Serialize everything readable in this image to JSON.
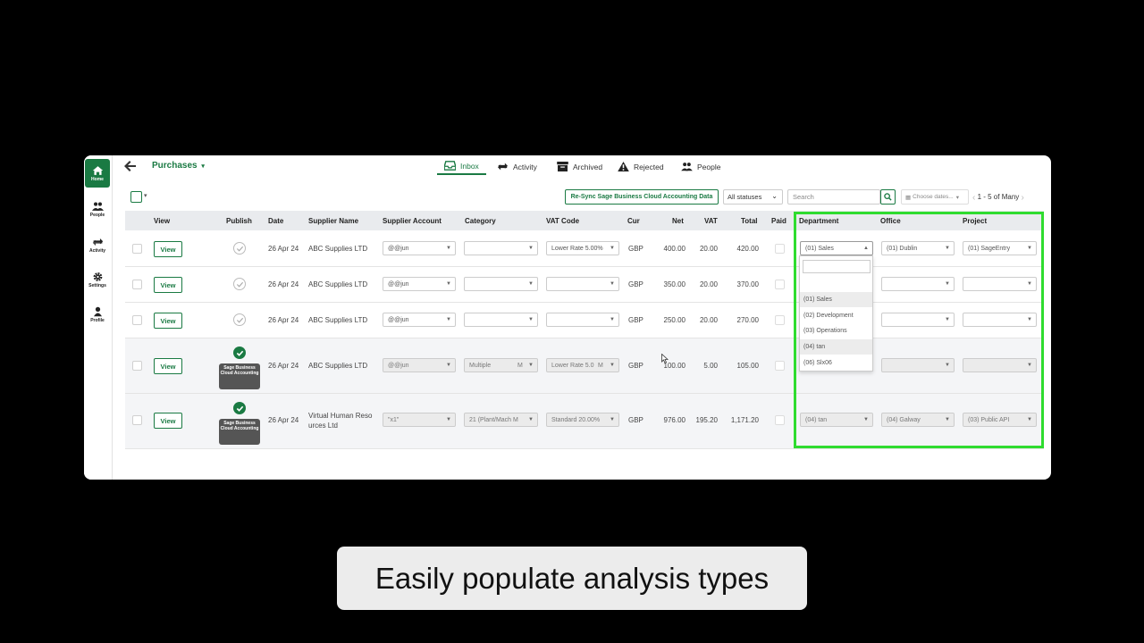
{
  "sidebar": {
    "items": [
      {
        "label": "Home",
        "icon": "home-icon",
        "active": true
      },
      {
        "label": "People",
        "icon": "people-icon"
      },
      {
        "label": "Activity",
        "icon": "activity-icon"
      },
      {
        "label": "Settings",
        "icon": "gear-icon"
      },
      {
        "label": "Profile",
        "icon": "profile-icon"
      }
    ]
  },
  "header": {
    "title": "Purchases",
    "tabs": [
      {
        "label": "Inbox",
        "active": true
      },
      {
        "label": "Activity"
      },
      {
        "label": "Archived"
      },
      {
        "label": "Rejected"
      },
      {
        "label": "People"
      }
    ]
  },
  "toolbar": {
    "resync_label": "Re-Sync Sage Business Cloud Accounting Data",
    "status_filter": "All statuses",
    "search_placeholder": "Search",
    "date_placeholder": "Choose dates...",
    "pagination": "1 - 5 of Many"
  },
  "table": {
    "columns": [
      "View",
      "Publish",
      "Date",
      "Supplier Name",
      "Supplier Account",
      "Category",
      "VAT Code",
      "Cur",
      "Net",
      "VAT",
      "Total",
      "Paid",
      "Department",
      "Office",
      "Project"
    ],
    "view_label": "View",
    "rows": [
      {
        "date": "26 Apr 24",
        "supplier": "ABC Supplies LTD",
        "account": "@@jun",
        "category": "",
        "vat_code": "Lower Rate 5.00%",
        "cur": "GBP",
        "net": "400.00",
        "vat": "20.00",
        "total": "420.00",
        "department": "(01) Sales",
        "office": "(01) Dublin",
        "project": "(01) SageEntry"
      },
      {
        "date": "26 Apr 24",
        "supplier": "ABC Supplies LTD",
        "account": "@@jun",
        "category": "",
        "vat_code": "",
        "cur": "GBP",
        "net": "350.00",
        "vat": "20.00",
        "total": "370.00",
        "department": "",
        "office": "",
        "project": ""
      },
      {
        "date": "26 Apr 24",
        "supplier": "ABC Supplies LTD",
        "account": "@@jun",
        "category": "",
        "vat_code": "",
        "cur": "GBP",
        "net": "250.00",
        "vat": "20.00",
        "total": "270.00",
        "department": "",
        "office": "",
        "project": ""
      },
      {
        "date": "26 Apr 24",
        "supplier": "ABC Supplies LTD",
        "account": "@@jun",
        "category": "Multiple",
        "category_suffix": "M",
        "vat_code": "Lower Rate 5.0",
        "vat_suffix": "M",
        "cur": "GBP",
        "net": "100.00",
        "vat": "5.00",
        "total": "105.00",
        "department": "",
        "office": "",
        "project": "",
        "badge": "Sage Business Cloud Accounting"
      },
      {
        "date": "26 Apr 24",
        "supplier": "Virtual Human Resources Ltd",
        "supplier_line1": "Virtual Human Reso",
        "supplier_line2": "urces Ltd",
        "account": "\"x1\"",
        "category": "21 (Plant/Mach M",
        "vat_code": "Standard 20.00%",
        "cur": "GBP",
        "net": "976.00",
        "vat": "195.20",
        "total": "1,171.20",
        "department": "(04) tan",
        "office": "(04) Galway",
        "project": "(03) Public API",
        "badge": "Sage Business Cloud Accounting"
      }
    ]
  },
  "department_dropdown": {
    "options": [
      "(01) Sales",
      "(02) Development",
      "(03) Operations",
      "(04) tan",
      "(06) Slx06"
    ]
  },
  "caption": "Easily populate analysis types",
  "colors": {
    "brand": "#1a7a43",
    "highlight": "#2fdc2f"
  }
}
